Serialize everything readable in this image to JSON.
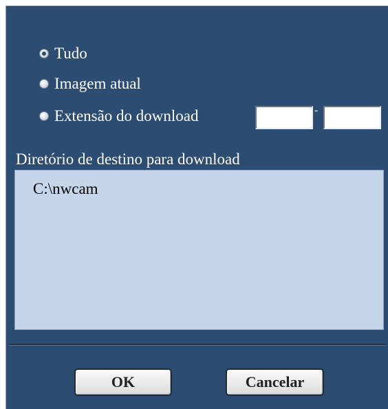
{
  "options": {
    "all_label": "Tudo",
    "current_label": "Imagem atual",
    "range_label": "Extensão do download",
    "range_separator": "-",
    "range_from": "",
    "range_to": "",
    "selected": "Tudo"
  },
  "directory": {
    "label": "Diretório de destino para download",
    "path": "C:\\nwcam"
  },
  "buttons": {
    "ok": "OK",
    "cancel": "Cancelar"
  },
  "colors": {
    "background": "#2d4c72",
    "path_box": "#c5d6ea"
  }
}
